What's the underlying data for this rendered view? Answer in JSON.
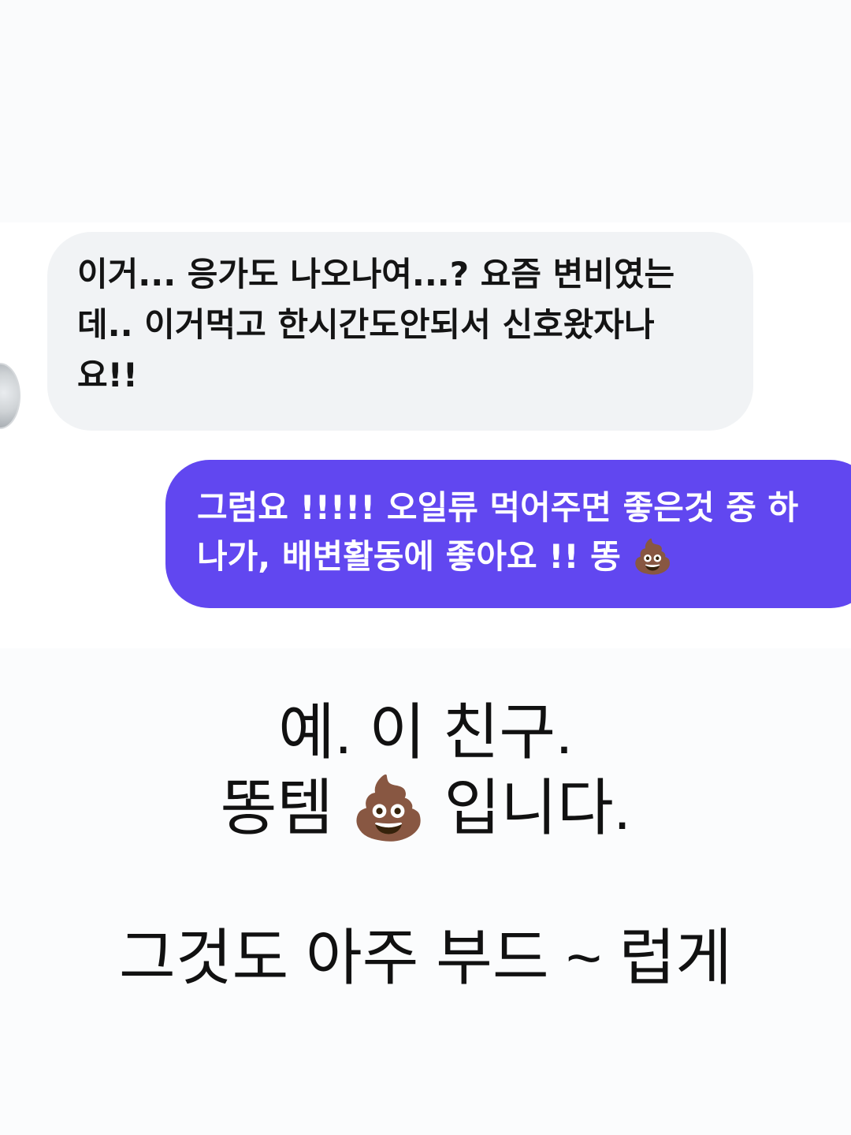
{
  "messages": {
    "received": {
      "line1": "이거... 응가도 나오나여...? 요즘 변비였는",
      "line2": "데.. 이거먹고 한시간도안되서 신호왔자나",
      "line3": "요!!"
    },
    "sent": {
      "line1": "그럼요 !!!!! 오일류 먹어주면 좋은것 중 하",
      "line2": "나가, 배변활동에 좋아요 !! 똥",
      "emoji": "💩"
    }
  },
  "caption": {
    "line1": "예. 이 친구.",
    "line2_part1": "똥템",
    "line2_emoji": "💩",
    "line2_part2": "입니다.",
    "line3": "그것도 아주 부드 ~ 럽게"
  }
}
